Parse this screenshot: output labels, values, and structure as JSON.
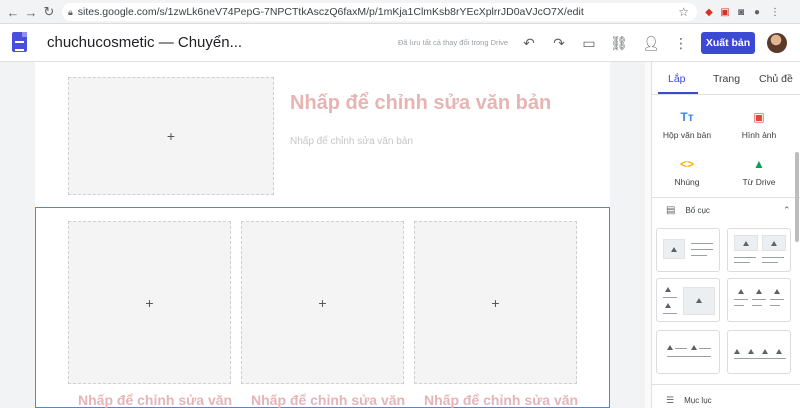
{
  "browser": {
    "url": "sites.google.com/s/1zwLk6neV74PepG-7NPCTtkAsczQ6faxM/p/1mKja1ClmKsb8rYEcXplrrJD0aVJcO7X/edit"
  },
  "header": {
    "site_title": "chuchucosmetic — Chuyển...",
    "save_note": "Đã lưu tất cả thay đổi trong Drive",
    "publish_label": "Xuất bản"
  },
  "canvas": {
    "top_section": {
      "heading": "Nhấp để chỉnh sửa văn bản",
      "subtext": "Nhấp để chỉnh sửa văn bản",
      "image_placeholder": "+"
    },
    "columns": [
      {
        "placeholder": "+",
        "heading": "Nhấp để chỉnh sửa văn"
      },
      {
        "placeholder": "+",
        "heading": "Nhấp để chỉnh sửa văn"
      },
      {
        "placeholder": "+",
        "heading": "Nhấp để chỉnh sửa văn"
      }
    ]
  },
  "panel": {
    "tabs": [
      "Lắp",
      "Trang",
      "Chủ đề"
    ],
    "active_tab": "Lắp",
    "inserts": [
      {
        "label": "Hộp văn bản",
        "icon": "text-box-icon",
        "glyph": "Tт",
        "color": "#4285f4"
      },
      {
        "label": "Hình ảnh",
        "icon": "image-icon",
        "glyph": "▣",
        "color": "#ea4335"
      },
      {
        "label": "Nhúng",
        "icon": "embed-icon",
        "glyph": "<>",
        "color": "#f4b400"
      },
      {
        "label": "Từ Drive",
        "icon": "drive-icon",
        "glyph": "▲",
        "color": "#0f9d58"
      }
    ],
    "layout_heading": "Bố cục",
    "toc_label": "Mục lục"
  },
  "colors": {
    "accent": "#3c4ad3",
    "placeholder_text": "#e8b4b3",
    "selection": "#4a86e8"
  }
}
